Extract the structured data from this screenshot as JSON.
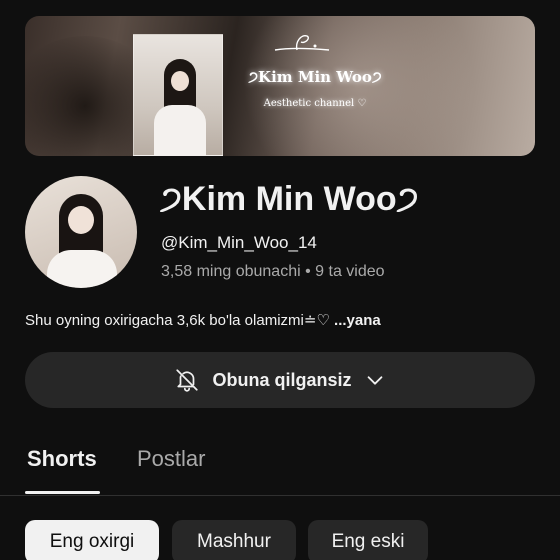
{
  "banner": {
    "name": "੭Kim Min Woo੭",
    "subtitle": "Aesthetic channel ♡"
  },
  "channel": {
    "title": "੭Kim Min Woo੭",
    "handle": "@Kim_Min_Woo_14",
    "stats": "3,58 ming obunachi • 9 ta video",
    "description": "Shu oyning oxirigacha 3,6k bo'la olamizmi≐♡",
    "description_more": "...yana"
  },
  "subscribe": {
    "label": "Obuna qilgansiz",
    "bell_icon": "bell-off-icon",
    "chevron_icon": "chevron-down-icon"
  },
  "tabs": [
    {
      "label": "Shorts",
      "active": true
    },
    {
      "label": "Postlar",
      "active": false
    }
  ],
  "chips": [
    {
      "label": "Eng oxirgi",
      "selected": true
    },
    {
      "label": "Mashhur",
      "selected": false
    },
    {
      "label": "Eng eski",
      "selected": false
    }
  ]
}
